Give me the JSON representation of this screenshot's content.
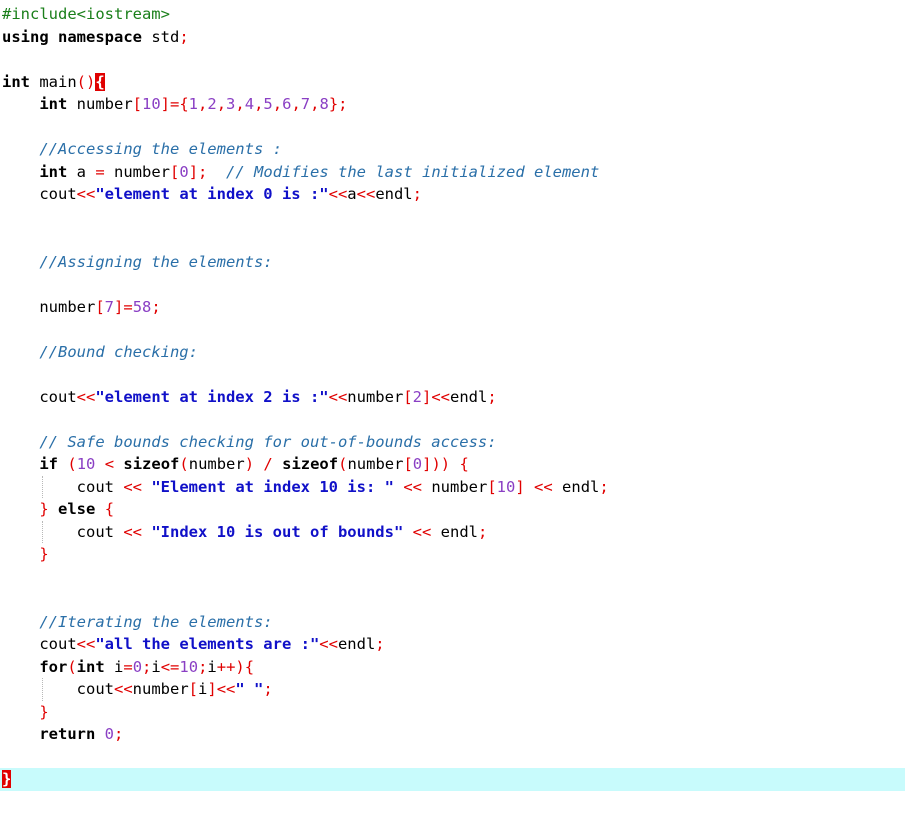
{
  "editor": {
    "colors": {
      "preprocessor": "#1a7f1a",
      "keyword": "#000000",
      "number": "#8a3fc4",
      "operator": "#e00000",
      "string": "#1010c8",
      "comment": "#2a6fa8",
      "current_line": "#c8fbfc",
      "brace_match": "#e00000"
    },
    "lines": [
      [
        {
          "t": "pre",
          "v": "#include<iostream>"
        }
      ],
      [
        {
          "t": "kw",
          "v": "using namespace"
        },
        {
          "t": "id",
          "v": " std"
        },
        {
          "t": "punc",
          "v": ";"
        }
      ],
      [],
      [
        {
          "t": "kw",
          "v": "int"
        },
        {
          "t": "id",
          "v": " main"
        },
        {
          "t": "punc",
          "v": "()"
        },
        {
          "t": "match",
          "v": "{"
        }
      ],
      [
        {
          "t": "id",
          "v": "    "
        },
        {
          "t": "kw",
          "v": "int"
        },
        {
          "t": "id",
          "v": " number"
        },
        {
          "t": "punc",
          "v": "["
        },
        {
          "t": "num",
          "v": "10"
        },
        {
          "t": "punc",
          "v": "]={"
        },
        {
          "t": "num",
          "v": "1"
        },
        {
          "t": "punc",
          "v": ","
        },
        {
          "t": "num",
          "v": "2"
        },
        {
          "t": "punc",
          "v": ","
        },
        {
          "t": "num",
          "v": "3"
        },
        {
          "t": "punc",
          "v": ","
        },
        {
          "t": "num",
          "v": "4"
        },
        {
          "t": "punc",
          "v": ","
        },
        {
          "t": "num",
          "v": "5"
        },
        {
          "t": "punc",
          "v": ","
        },
        {
          "t": "num",
          "v": "6"
        },
        {
          "t": "punc",
          "v": ","
        },
        {
          "t": "num",
          "v": "7"
        },
        {
          "t": "punc",
          "v": ","
        },
        {
          "t": "num",
          "v": "8"
        },
        {
          "t": "punc",
          "v": "};"
        }
      ],
      [],
      [
        {
          "t": "id",
          "v": "    "
        },
        {
          "t": "cmt",
          "v": "//Accessing the elements :"
        }
      ],
      [
        {
          "t": "id",
          "v": "    "
        },
        {
          "t": "kw",
          "v": "int"
        },
        {
          "t": "id",
          "v": " a "
        },
        {
          "t": "op",
          "v": "="
        },
        {
          "t": "id",
          "v": " number"
        },
        {
          "t": "punc",
          "v": "["
        },
        {
          "t": "num",
          "v": "0"
        },
        {
          "t": "punc",
          "v": "];"
        },
        {
          "t": "id",
          "v": "  "
        },
        {
          "t": "cmt",
          "v": "// Modifies the last initialized element"
        }
      ],
      [
        {
          "t": "id",
          "v": "    cout"
        },
        {
          "t": "op",
          "v": "<<"
        },
        {
          "t": "str",
          "v": "\"element at index 0 is :\""
        },
        {
          "t": "op",
          "v": "<<"
        },
        {
          "t": "id",
          "v": "a"
        },
        {
          "t": "op",
          "v": "<<"
        },
        {
          "t": "id",
          "v": "endl"
        },
        {
          "t": "punc",
          "v": ";"
        }
      ],
      [],
      [],
      [
        {
          "t": "id",
          "v": "    "
        },
        {
          "t": "cmt",
          "v": "//Assigning the elements:"
        }
      ],
      [],
      [
        {
          "t": "id",
          "v": "    number"
        },
        {
          "t": "punc",
          "v": "["
        },
        {
          "t": "num",
          "v": "7"
        },
        {
          "t": "punc",
          "v": "]="
        },
        {
          "t": "num",
          "v": "58"
        },
        {
          "t": "punc",
          "v": ";"
        }
      ],
      [],
      [
        {
          "t": "id",
          "v": "    "
        },
        {
          "t": "cmt",
          "v": "//Bound checking:"
        }
      ],
      [],
      [
        {
          "t": "id",
          "v": "    cout"
        },
        {
          "t": "op",
          "v": "<<"
        },
        {
          "t": "str",
          "v": "\"element at index 2 is :\""
        },
        {
          "t": "op",
          "v": "<<"
        },
        {
          "t": "id",
          "v": "number"
        },
        {
          "t": "punc",
          "v": "["
        },
        {
          "t": "num",
          "v": "2"
        },
        {
          "t": "punc",
          "v": "]"
        },
        {
          "t": "op",
          "v": "<<"
        },
        {
          "t": "id",
          "v": "endl"
        },
        {
          "t": "punc",
          "v": ";"
        }
      ],
      [],
      [
        {
          "t": "id",
          "v": "    "
        },
        {
          "t": "cmt",
          "v": "// Safe bounds checking for out-of-bounds access:"
        }
      ],
      [
        {
          "t": "id",
          "v": "    "
        },
        {
          "t": "kw",
          "v": "if"
        },
        {
          "t": "id",
          "v": " "
        },
        {
          "t": "punc",
          "v": "("
        },
        {
          "t": "num",
          "v": "10"
        },
        {
          "t": "id",
          "v": " "
        },
        {
          "t": "op",
          "v": "<"
        },
        {
          "t": "id",
          "v": " "
        },
        {
          "t": "kw",
          "v": "sizeof"
        },
        {
          "t": "punc",
          "v": "("
        },
        {
          "t": "id",
          "v": "number"
        },
        {
          "t": "punc",
          "v": ")"
        },
        {
          "t": "id",
          "v": " "
        },
        {
          "t": "op",
          "v": "/"
        },
        {
          "t": "id",
          "v": " "
        },
        {
          "t": "kw",
          "v": "sizeof"
        },
        {
          "t": "punc",
          "v": "("
        },
        {
          "t": "id",
          "v": "number"
        },
        {
          "t": "punc",
          "v": "["
        },
        {
          "t": "num",
          "v": "0"
        },
        {
          "t": "punc",
          "v": "]))"
        },
        {
          "t": "id",
          "v": " "
        },
        {
          "t": "punc",
          "v": "{"
        }
      ],
      [
        {
          "t": "id",
          "v": "        cout "
        },
        {
          "t": "op",
          "v": "<<"
        },
        {
          "t": "id",
          "v": " "
        },
        {
          "t": "str",
          "v": "\"Element at index 10 is: \""
        },
        {
          "t": "id",
          "v": " "
        },
        {
          "t": "op",
          "v": "<<"
        },
        {
          "t": "id",
          "v": " number"
        },
        {
          "t": "punc",
          "v": "["
        },
        {
          "t": "num",
          "v": "10"
        },
        {
          "t": "punc",
          "v": "]"
        },
        {
          "t": "id",
          "v": " "
        },
        {
          "t": "op",
          "v": "<<"
        },
        {
          "t": "id",
          "v": " endl"
        },
        {
          "t": "punc",
          "v": ";"
        }
      ],
      [
        {
          "t": "id",
          "v": "    "
        },
        {
          "t": "punc",
          "v": "}"
        },
        {
          "t": "id",
          "v": " "
        },
        {
          "t": "kw",
          "v": "else"
        },
        {
          "t": "id",
          "v": " "
        },
        {
          "t": "punc",
          "v": "{"
        }
      ],
      [
        {
          "t": "id",
          "v": "        cout "
        },
        {
          "t": "op",
          "v": "<<"
        },
        {
          "t": "id",
          "v": " "
        },
        {
          "t": "str",
          "v": "\"Index 10 is out of bounds\""
        },
        {
          "t": "id",
          "v": " "
        },
        {
          "t": "op",
          "v": "<<"
        },
        {
          "t": "id",
          "v": " endl"
        },
        {
          "t": "punc",
          "v": ";"
        }
      ],
      [
        {
          "t": "id",
          "v": "    "
        },
        {
          "t": "punc",
          "v": "}"
        }
      ],
      [],
      [],
      [
        {
          "t": "id",
          "v": "    "
        },
        {
          "t": "cmt",
          "v": "//Iterating the elements:"
        }
      ],
      [
        {
          "t": "id",
          "v": "    cout"
        },
        {
          "t": "op",
          "v": "<<"
        },
        {
          "t": "str",
          "v": "\"all the elements are :\""
        },
        {
          "t": "op",
          "v": "<<"
        },
        {
          "t": "id",
          "v": "endl"
        },
        {
          "t": "punc",
          "v": ";"
        }
      ],
      [
        {
          "t": "id",
          "v": "    "
        },
        {
          "t": "kw",
          "v": "for"
        },
        {
          "t": "punc",
          "v": "("
        },
        {
          "t": "kw",
          "v": "int"
        },
        {
          "t": "id",
          "v": " i"
        },
        {
          "t": "op",
          "v": "="
        },
        {
          "t": "num",
          "v": "0"
        },
        {
          "t": "punc",
          "v": ";"
        },
        {
          "t": "id",
          "v": "i"
        },
        {
          "t": "op",
          "v": "<="
        },
        {
          "t": "num",
          "v": "10"
        },
        {
          "t": "punc",
          "v": ";"
        },
        {
          "t": "id",
          "v": "i"
        },
        {
          "t": "op",
          "v": "++"
        },
        {
          "t": "punc",
          "v": "){"
        }
      ],
      [
        {
          "t": "id",
          "v": "        cout"
        },
        {
          "t": "op",
          "v": "<<"
        },
        {
          "t": "id",
          "v": "number"
        },
        {
          "t": "punc",
          "v": "["
        },
        {
          "t": "id",
          "v": "i"
        },
        {
          "t": "punc",
          "v": "]"
        },
        {
          "t": "op",
          "v": "<<"
        },
        {
          "t": "str",
          "v": "\" \""
        },
        {
          "t": "punc",
          "v": ";"
        }
      ],
      [
        {
          "t": "id",
          "v": "    "
        },
        {
          "t": "punc",
          "v": "}"
        }
      ],
      [
        {
          "t": "id",
          "v": "    "
        },
        {
          "t": "kw",
          "v": "return"
        },
        {
          "t": "id",
          "v": " "
        },
        {
          "t": "num",
          "v": "0"
        },
        {
          "t": "punc",
          "v": ";"
        }
      ],
      [],
      [
        {
          "t": "match",
          "v": "}"
        }
      ]
    ]
  }
}
